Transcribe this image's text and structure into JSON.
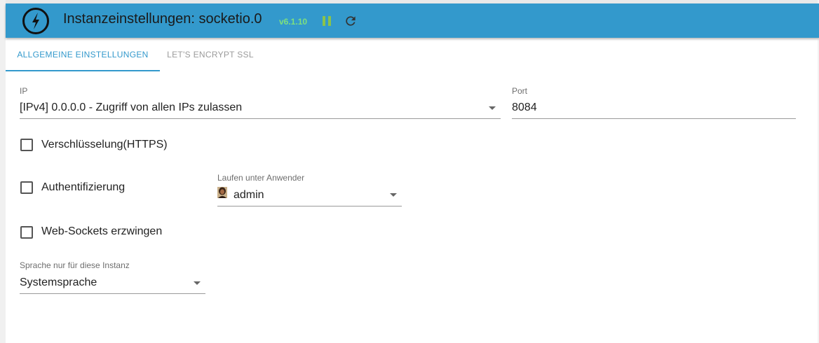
{
  "header": {
    "title": "Instanzeinstellungen: socketio.0",
    "version": "v6.1.10",
    "icons": {
      "logo": "socketio-lightning-icon",
      "pause": "pause-icon",
      "reload": "reload-icon"
    },
    "colors": {
      "bar": "#3399cc",
      "version": "#7ee07e",
      "pause": "#8bc34a"
    }
  },
  "tabs": [
    {
      "label": "Allgemeine Einstellungen",
      "active": true
    },
    {
      "label": "Let's Encrypt SSL",
      "active": false
    }
  ],
  "form": {
    "ip": {
      "label": "IP",
      "value": "[IPv4] 0.0.0.0 - Zugriff von allen IPs zulassen"
    },
    "port": {
      "label": "Port",
      "value": "8084"
    },
    "https": {
      "label": "Verschlüsselung(HTTPS)",
      "checked": false
    },
    "auth": {
      "label": "Authentifizierung",
      "checked": false
    },
    "run_as": {
      "label": "Laufen unter Anwender",
      "value": "admin"
    },
    "websockets": {
      "label": "Web-Sockets erzwingen",
      "checked": false
    },
    "language": {
      "label": "Sprache nur für diese Instanz",
      "value": "Systemsprache"
    }
  }
}
